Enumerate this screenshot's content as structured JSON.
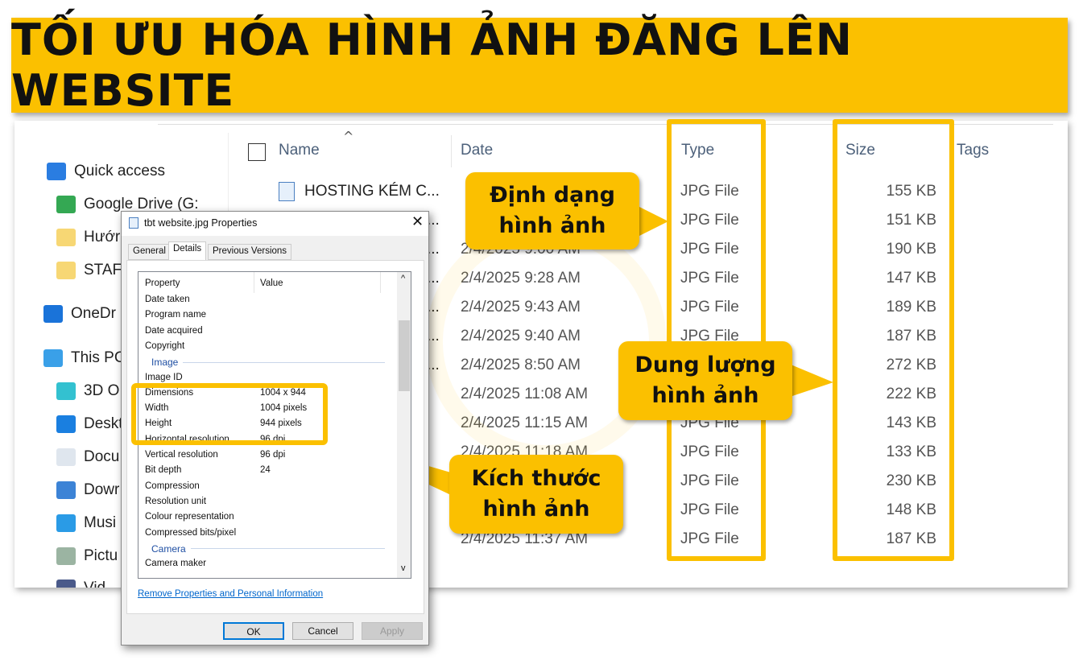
{
  "banner": {
    "title": "TỐI ƯU HÓA HÌNH ẢNH ĐĂNG LÊN WEBSITE"
  },
  "accent_color": "#FBC000",
  "sidebar": {
    "items": [
      {
        "label": "Quick access",
        "icon": "star-icon"
      },
      {
        "label": "Google Drive (G:",
        "icon": "google-drive-icon"
      },
      {
        "label": "Hướr",
        "icon": "contact-folder-icon"
      },
      {
        "label": "STAFI",
        "icon": "folder-icon"
      },
      {
        "label": "OneDr",
        "icon": "onedrive-cloud-icon"
      },
      {
        "label": "This PC",
        "icon": "computer-icon"
      },
      {
        "label": "3D O",
        "icon": "3d-objects-icon"
      },
      {
        "label": "Deskt",
        "icon": "desktop-icon"
      },
      {
        "label": "Docu",
        "icon": "documents-icon"
      },
      {
        "label": "Dowr",
        "icon": "download-arrow-icon"
      },
      {
        "label": "Musi",
        "icon": "music-note-icon"
      },
      {
        "label": "Pictu",
        "icon": "pictures-icon"
      },
      {
        "label": "Vid",
        "icon": "videos-icon"
      }
    ]
  },
  "columns": {
    "name": "Name",
    "date": "Date",
    "type": "Type",
    "size": "Size",
    "tags": "Tags"
  },
  "files": [
    {
      "name": "HOSTING KÉM C...",
      "date": "",
      "type": "JPG File",
      "size": "155 KB"
    },
    {
      "name": "...",
      "date": "",
      "type": "JPG File",
      "size": "151 KB"
    },
    {
      "name": "...",
      "date": "2/4/2025 9:00 AM",
      "type": "JPG File",
      "size": "190 KB"
    },
    {
      "name": "...",
      "date": "2/4/2025 9:28 AM",
      "type": "JPG File",
      "size": "147 KB"
    },
    {
      "name": "...",
      "date": "2/4/2025 9:43 AM",
      "type": "JPG File",
      "size": "189 KB"
    },
    {
      "name": "...",
      "date": "2/4/2025 9:40 AM",
      "type": "JPG File",
      "size": "187 KB"
    },
    {
      "name": "...",
      "date": "2/4/2025 8:50 AM",
      "type": "JPG File",
      "size": "272 KB"
    },
    {
      "name": "",
      "date": "2/4/2025 11:08 AM",
      "type": "JPG File",
      "size": "222 KB"
    },
    {
      "name": "",
      "date": "2/4/2025 11:15 AM",
      "type": "JPG File",
      "size": "143 KB"
    },
    {
      "name": "",
      "date": "2/4/2025 11:18 AM",
      "type": "JPG File",
      "size": "133 KB"
    },
    {
      "name": "",
      "date": "",
      "type": "JPG File",
      "size": "230 KB"
    },
    {
      "name": "",
      "date": "",
      "type": "JPG File",
      "size": "148 KB"
    },
    {
      "name": "",
      "date": "2/4/2025 11:37 AM",
      "type": "JPG File",
      "size": "187 KB"
    }
  ],
  "callouts": {
    "format": [
      "Định dạng",
      "hình ảnh"
    ],
    "size": [
      "Dung lượng",
      "hình ảnh"
    ],
    "dimensions": [
      "Kích thước",
      "hình ảnh"
    ]
  },
  "dialog": {
    "title": "tbt website.jpg Properties",
    "tabs": [
      "General",
      "Details",
      "Previous Versions"
    ],
    "active_tab": "Details",
    "col_property": "Property",
    "col_value": "Value",
    "rows": [
      {
        "p": "Date taken",
        "v": ""
      },
      {
        "p": "Program name",
        "v": ""
      },
      {
        "p": "Date acquired",
        "v": ""
      },
      {
        "p": "Copyright",
        "v": ""
      },
      {
        "section": "Image"
      },
      {
        "p": "Image ID",
        "v": ""
      },
      {
        "p": "Dimensions",
        "v": "1004 x 944"
      },
      {
        "p": "Width",
        "v": "1004 pixels"
      },
      {
        "p": "Height",
        "v": "944 pixels"
      },
      {
        "p": "Horizontal resolution",
        "v": "96 dpi"
      },
      {
        "p": "Vertical resolution",
        "v": "96 dpi"
      },
      {
        "p": "Bit depth",
        "v": "24"
      },
      {
        "p": "Compression",
        "v": ""
      },
      {
        "p": "Resolution unit",
        "v": ""
      },
      {
        "p": "Colour representation",
        "v": ""
      },
      {
        "p": "Compressed bits/pixel",
        "v": ""
      },
      {
        "section": "Camera"
      },
      {
        "p": "Camera maker",
        "v": ""
      }
    ],
    "link": "Remove Properties and Personal Information",
    "ok": "OK",
    "cancel": "Cancel",
    "apply": "Apply"
  }
}
